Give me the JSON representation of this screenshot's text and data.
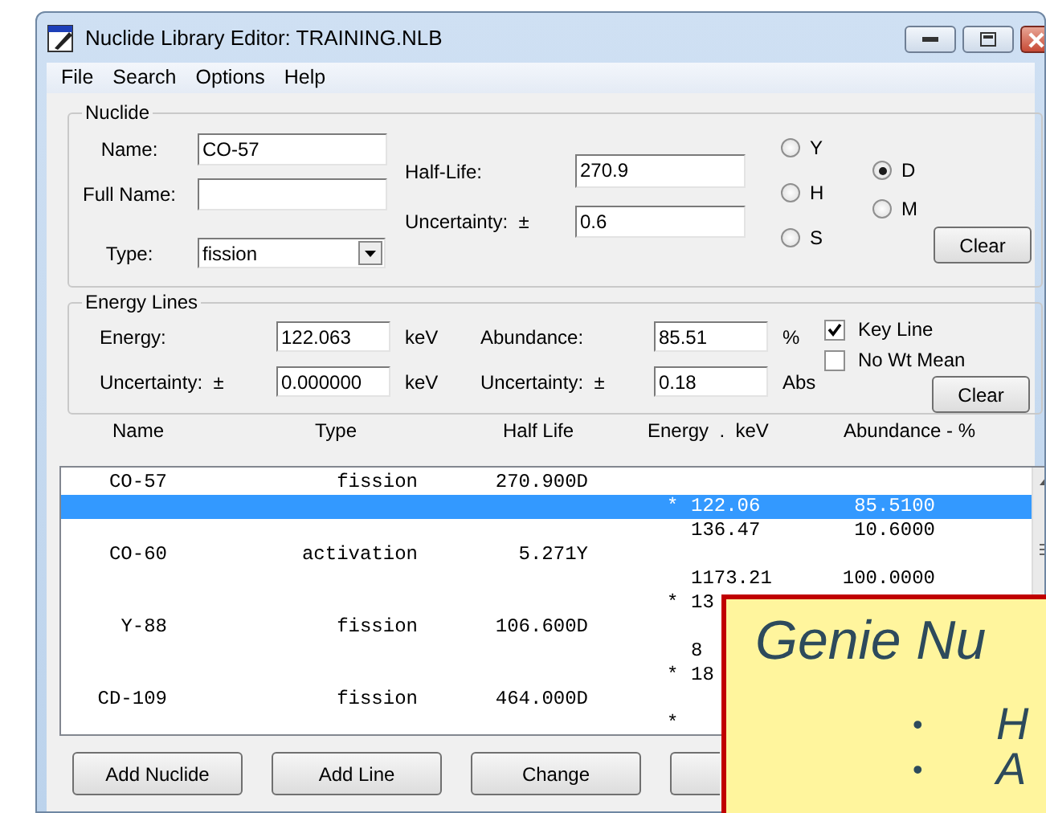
{
  "window": {
    "title": "Nuclide Library Editor: TRAINING.NLB"
  },
  "menu": [
    {
      "label": "File"
    },
    {
      "label": "Search"
    },
    {
      "label": "Options"
    },
    {
      "label": "Help"
    }
  ],
  "nuclide": {
    "legend": "Nuclide",
    "name_label": "Name:",
    "name": "CO-57",
    "full_name_label": "Full Name:",
    "type_label": "Type:",
    "type": "fission",
    "half_life_label": "Half-Life:",
    "half_life": "270.9",
    "uncertainty_label": "Uncertainty:  ±",
    "uncertainty": "0.6",
    "units": [
      {
        "label": "Y",
        "selected": false
      },
      {
        "label": "H",
        "selected": false
      },
      {
        "label": "S",
        "selected": false
      },
      {
        "label": "D",
        "selected": true
      },
      {
        "label": "M",
        "selected": false
      }
    ],
    "clear": "Clear"
  },
  "energy_lines": {
    "legend": "Energy Lines",
    "energy_label": "Energy:",
    "energy": "122.063",
    "energy_unit": "keV",
    "energy_uncertainty_label": "Uncertainty:  ±",
    "energy_uncertainty": "0.000000",
    "energy_uncertainty_unit": "keV",
    "abundance_label": "Abundance:",
    "abundance": "85.51",
    "abundance_unit": "%",
    "abundance_uncertainty_label": "Uncertainty:  ±",
    "abundance_uncertainty": "0.18",
    "abundance_uncertainty_unit": "Abs",
    "options": [
      {
        "label": "Key Line",
        "checked": true
      },
      {
        "label": "No Wt Mean",
        "checked": false
      }
    ],
    "clear": "Clear"
  },
  "list": {
    "columns": [
      "Name",
      "Type",
      "Half Life",
      "Energy  .  keV",
      "Abundance - %"
    ],
    "rows": [
      {
        "name": "CO-57",
        "type": "fission",
        "half_life": "270.900D",
        "selected": false
      },
      {
        "marker": "*",
        "energy": "122.06",
        "abundance": "85.5100",
        "selected": true
      },
      {
        "energy": "136.47",
        "abundance": "10.6000",
        "selected": false
      },
      {
        "name": "CO-60",
        "type": "activation",
        "half_life": "5.271Y",
        "selected": false
      },
      {
        "energy": "1173.21",
        "abundance": "100.0000",
        "selected": false
      },
      {
        "marker": "*",
        "energy": "13",
        "selected": false
      },
      {
        "name": "Y-88",
        "type": "fission",
        "half_life": "106.600D",
        "selected": false
      },
      {
        "energy": "8",
        "selected": false
      },
      {
        "marker": "*",
        "energy": "18",
        "selected": false
      },
      {
        "name": "CD-109",
        "type": "fission",
        "half_life": "464.000D",
        "selected": false
      },
      {
        "marker": "*",
        "selected": false
      }
    ]
  },
  "buttons": [
    {
      "label": "Add Nuclide"
    },
    {
      "label": "Add Line"
    },
    {
      "label": "Change"
    }
  ],
  "callout": {
    "title": "Genie Nu",
    "bullets": [
      {
        "marker": "•",
        "text": "H"
      },
      {
        "marker": "•",
        "text": "A"
      }
    ]
  }
}
